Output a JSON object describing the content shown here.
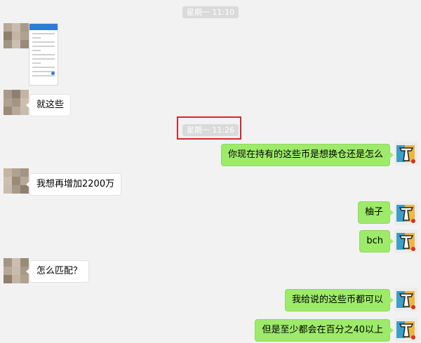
{
  "timestamps": [
    "星期一 11:10",
    "星期一 11:26"
  ],
  "contact_avatar": {
    "colors": [
      "#b7a898",
      "#c9bcae",
      "#a89a89",
      "#8f7f6e",
      "#c4b4a3",
      "#b0a190",
      "#a39584",
      "#cdbfb0",
      "#9a8a78"
    ]
  },
  "messages": [
    {
      "side": "left",
      "type": "image",
      "alt": "phone-screenshot"
    },
    {
      "side": "left",
      "text": "就这些"
    },
    {
      "side": "right",
      "text": "你现在持有的这些币是想换仓还是怎么"
    },
    {
      "side": "left",
      "text": "我想再增加2200万"
    },
    {
      "side": "right",
      "text": "柚子"
    },
    {
      "side": "right",
      "text": "bch"
    },
    {
      "side": "left",
      "text": "怎么匹配？"
    },
    {
      "side": "right",
      "text": "我给说的这些币都可以"
    },
    {
      "side": "right",
      "text": "但是至少都会在百分之40以上"
    }
  ],
  "colors": {
    "bubble_right": "#9eea6a",
    "bubble_left": "#ffffff",
    "timestamp_bg": "#dadada",
    "highlight": "#d8262c"
  }
}
